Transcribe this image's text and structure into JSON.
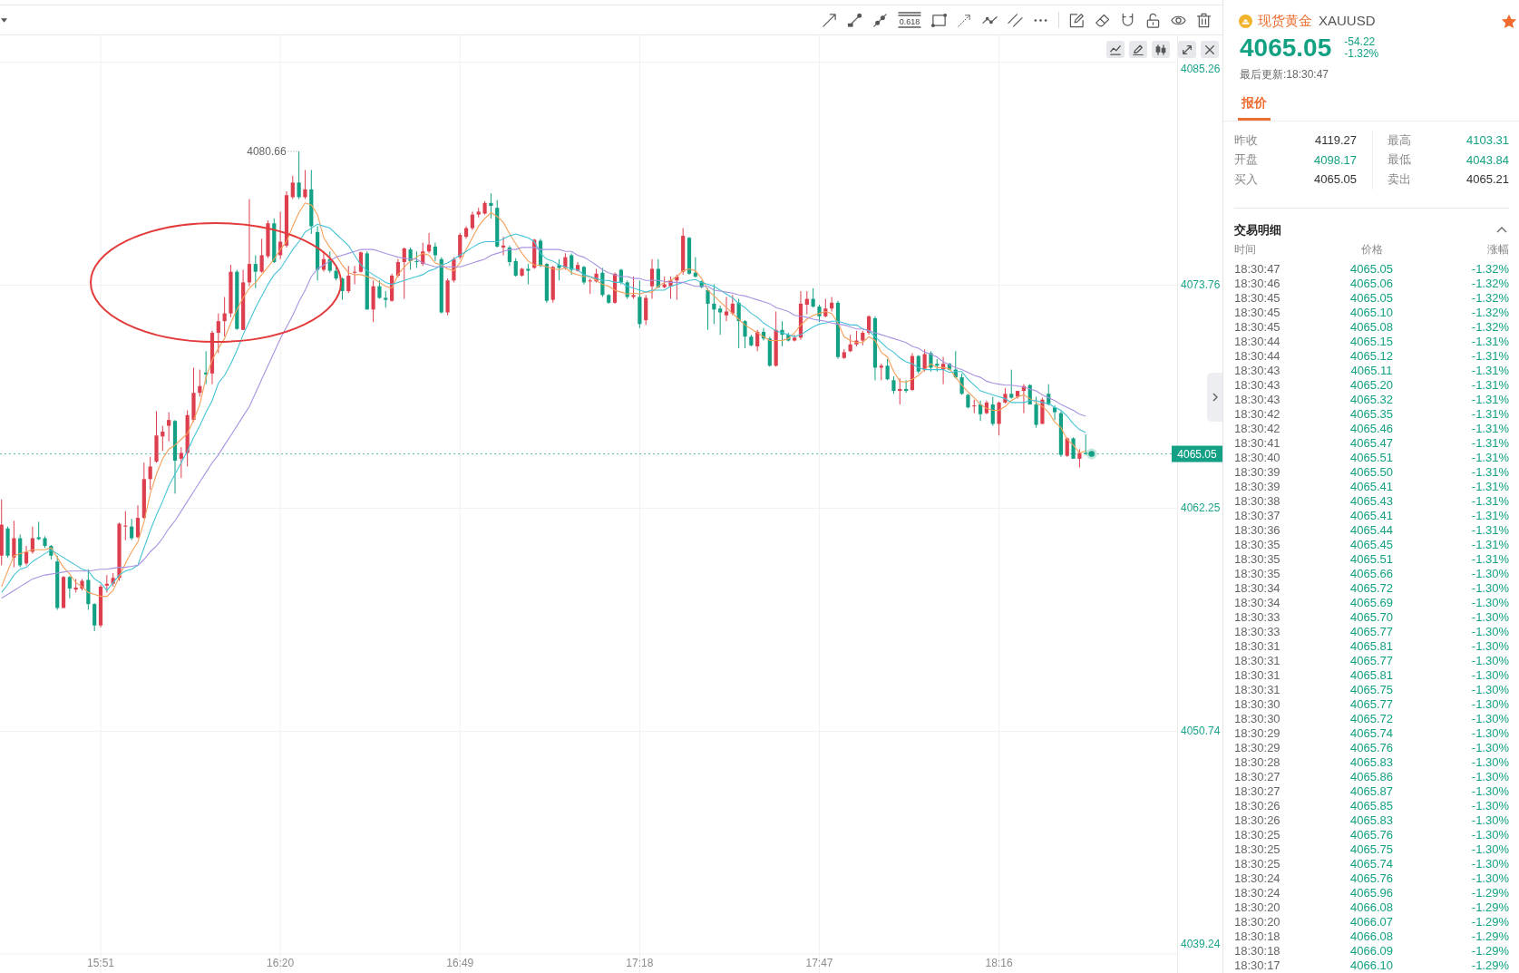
{
  "toolbar": {
    "fib_caption": "0.618"
  },
  "chart": {
    "chart_data": [
      {
        "type": "candlestick",
        "grid": true,
        "ylim": [
          4039.2,
          4086.6
        ],
        "yticks": [
          4085.26,
          4073.76,
          4062.25,
          4050.74,
          4039.24
        ],
        "categories": [
          null,
          null,
          null,
          null,
          null,
          null,
          null,
          null,
          null,
          null,
          null,
          null,
          null,
          null,
          null,
          null,
          "15:51",
          null,
          null,
          null,
          null,
          null,
          null,
          null,
          null,
          null,
          null,
          null,
          null,
          null,
          null,
          null,
          null,
          null,
          null,
          null,
          null,
          null,
          null,
          null,
          null,
          null,
          null,
          null,
          null,
          "16:20",
          null,
          null,
          null,
          null,
          null,
          null,
          null,
          null,
          null,
          null,
          null,
          null,
          null,
          null,
          null,
          null,
          null,
          null,
          null,
          null,
          null,
          null,
          null,
          null,
          null,
          null,
          null,
          null,
          "16:49",
          null,
          null,
          null,
          null,
          null,
          null,
          null,
          null,
          null,
          null,
          null,
          null,
          null,
          null,
          null,
          null,
          null,
          null,
          null,
          null,
          null,
          null,
          null,
          null,
          null,
          null,
          null,
          null,
          "17:18",
          null,
          null,
          null,
          null,
          null,
          null,
          null,
          null,
          null,
          null,
          null,
          null,
          null,
          null,
          null,
          null,
          null,
          null,
          null,
          null,
          null,
          null,
          null,
          null,
          null,
          null,
          null,
          null,
          "17:47",
          null,
          null,
          null,
          null,
          null,
          null,
          null,
          null,
          null,
          null,
          null,
          null,
          null,
          null,
          null,
          null,
          null,
          null,
          null,
          null,
          null,
          null,
          null,
          null,
          null,
          null,
          null,
          null,
          "18:16",
          null,
          null,
          null,
          null,
          null,
          null,
          null,
          null,
          null,
          null,
          null,
          null,
          null,
          null
        ],
        "ohlc": [
          [
            4059.8,
            4062.7,
            4059.3,
            4061.4
          ],
          [
            4061.2,
            4061.3,
            4059.7,
            4059.8
          ],
          [
            4059.7,
            4061.6,
            4059.2,
            4060.7
          ],
          [
            4060.7,
            4060.9,
            4059.2,
            4059.3
          ],
          [
            4059.4,
            4060.3,
            4059.3,
            4060.0
          ],
          [
            4060.0,
            4061.3,
            4059.9,
            4060.7
          ],
          [
            4060.75,
            4061.55,
            4060.6,
            4060.65
          ],
          [
            4060.7,
            4060.8,
            4060.2,
            4060.3
          ],
          [
            4060.3,
            4060.35,
            4059.6,
            4059.8
          ],
          [
            4059.5,
            4059.8,
            4057.0,
            4057.1
          ],
          [
            4057.1,
            4058.75,
            4057.1,
            4058.7
          ],
          [
            4058.7,
            4058.75,
            4057.6,
            4058.1
          ],
          [
            4058.05,
            4058.6,
            4057.9,
            4058.15
          ],
          [
            4058.1,
            4058.6,
            4058.0,
            4058.5
          ],
          [
            4058.55,
            4059.1,
            4057.0,
            4057.3
          ],
          [
            4057.3,
            4057.35,
            4055.9,
            4056.2
          ],
          [
            4056.2,
            4058.3,
            4056.1,
            4058.2
          ],
          [
            4058.25,
            4058.8,
            4057.9,
            4058.35
          ],
          [
            4058.35,
            4058.9,
            4058.2,
            4058.65
          ],
          [
            4058.65,
            4061.5,
            4058.5,
            4061.45
          ],
          [
            4061.3,
            4062.1,
            4060.6,
            4061.35
          ],
          [
            4061.3,
            4061.7,
            4060.6,
            4060.7
          ],
          [
            4060.75,
            4062.4,
            4060.7,
            4061.75
          ],
          [
            4061.75,
            4064.6,
            4061.7,
            4063.75
          ],
          [
            4063.75,
            4064.9,
            4063.2,
            4064.4
          ],
          [
            4064.65,
            4067.25,
            4064.6,
            4066.0
          ],
          [
            4065.95,
            4066.5,
            4065.2,
            4066.2
          ],
          [
            4066.5,
            4067.2,
            4065.7,
            4066.8
          ],
          [
            4066.75,
            4066.8,
            4063.0,
            4064.7
          ],
          [
            4064.8,
            4065.4,
            4063.8,
            4065.1
          ],
          [
            4065.1,
            4067.3,
            4064.4,
            4067.05
          ],
          [
            4066.8,
            4069.5,
            4066.7,
            4068.2
          ],
          [
            4068.2,
            4069.4,
            4068.0,
            4068.55
          ],
          [
            4069.25,
            4070.35,
            4068.65,
            4069.15
          ],
          [
            4069.2,
            4071.4,
            4068.65,
            4071.3
          ],
          [
            4071.3,
            4072.3,
            4070.25,
            4071.9
          ],
          [
            4071.9,
            4073.15,
            4071.1,
            4072.3
          ],
          [
            4072.3,
            4074.8,
            4072.1,
            4074.45
          ],
          [
            4074.45,
            4074.55,
            4071.45,
            4071.5
          ],
          [
            4071.45,
            4074.55,
            4071.45,
            4073.9
          ],
          [
            4073.9,
            4078.2,
            4073.7,
            4074.85
          ],
          [
            4074.85,
            4075.3,
            4073.6,
            4074.45
          ],
          [
            4074.45,
            4076.15,
            4074.4,
            4075.3
          ],
          [
            4075.25,
            4077.1,
            4075.15,
            4076.95
          ],
          [
            4076.95,
            4077.2,
            4074.9,
            4074.95
          ],
          [
            4075.3,
            4077.55,
            4075.1,
            4076.0
          ],
          [
            4075.8,
            4078.6,
            4075.7,
            4078.4
          ],
          [
            4078.3,
            4079.4,
            4078.2,
            4079.05
          ],
          [
            4079.05,
            4080.66,
            4078.2,
            4078.3
          ],
          [
            4078.3,
            4079.7,
            4078.2,
            4078.7
          ],
          [
            4078.7,
            4079.7,
            4076.4,
            4076.8
          ],
          [
            4076.5,
            4076.8,
            4074.0,
            4074.55
          ],
          [
            4074.55,
            4075.5,
            4074.45,
            4075.1
          ],
          [
            4075.1,
            4075.5,
            4074.4,
            4074.5
          ],
          [
            4074.5,
            4074.75,
            4074.0,
            4074.1
          ],
          [
            4074.1,
            4074.15,
            4073.0,
            4073.45
          ],
          [
            4073.45,
            4074.75,
            4073.35,
            4074.25
          ],
          [
            4074.4,
            4074.75,
            4073.8,
            4074.45
          ],
          [
            4074.45,
            4075.5,
            4074.4,
            4075.45
          ],
          [
            4075.4,
            4075.5,
            4072.5,
            4072.5
          ],
          [
            4072.5,
            4074.0,
            4071.85,
            4073.7
          ],
          [
            4073.7,
            4074.0,
            4073.05,
            4073.1
          ],
          [
            4073.1,
            4073.45,
            4072.6,
            4073.0
          ],
          [
            4072.95,
            4074.35,
            4072.9,
            4074.25
          ],
          [
            4074.25,
            4075.1,
            4074.15,
            4074.95
          ],
          [
            4074.95,
            4075.7,
            4073.05,
            4075.65
          ],
          [
            4075.6,
            4075.7,
            4074.55,
            4075.0
          ],
          [
            4075.0,
            4075.5,
            4074.65,
            4074.95
          ],
          [
            4074.85,
            4075.95,
            4074.75,
            4075.5
          ],
          [
            4075.5,
            4076.45,
            4075.4,
            4075.85
          ],
          [
            4075.75,
            4075.95,
            4075.0,
            4075.3
          ],
          [
            4075.1,
            4075.2,
            4072.3,
            4072.35
          ],
          [
            4072.35,
            4074.1,
            4072.2,
            4074.0
          ],
          [
            4074.0,
            4075.2,
            4073.9,
            4075.1
          ],
          [
            4075.2,
            4076.45,
            4075.1,
            4076.35
          ],
          [
            4076.25,
            4076.8,
            4076.15,
            4076.7
          ],
          [
            4076.7,
            4077.55,
            4076.6,
            4077.4
          ],
          [
            4077.4,
            4077.75,
            4077.25,
            4077.55
          ],
          [
            4077.45,
            4078.1,
            4077.4,
            4078.0
          ],
          [
            4078.0,
            4078.5,
            4077.2,
            4077.85
          ],
          [
            4077.75,
            4078.15,
            4075.7,
            4075.75
          ],
          [
            4075.7,
            4076.25,
            4075.3,
            4075.8
          ],
          [
            4075.7,
            4075.8,
            4074.75,
            4074.95
          ],
          [
            4075.0,
            4075.15,
            4074.2,
            4074.25
          ],
          [
            4074.25,
            4074.65,
            4074.2,
            4074.6
          ],
          [
            4074.6,
            4074.85,
            4073.8,
            4074.5
          ],
          [
            4074.65,
            4076.15,
            4074.6,
            4076.1
          ],
          [
            4076.05,
            4076.15,
            4074.7,
            4074.75
          ],
          [
            4074.85,
            4074.9,
            4072.85,
            4072.95
          ],
          [
            4073.0,
            4074.75,
            4072.85,
            4074.7
          ],
          [
            4074.8,
            4075.1,
            4074.0,
            4074.65
          ],
          [
            4074.65,
            4075.4,
            4074.55,
            4075.2
          ],
          [
            4075.3,
            4075.4,
            4074.3,
            4074.55
          ],
          [
            4074.5,
            4074.95,
            4074.45,
            4074.8
          ],
          [
            4074.7,
            4074.75,
            4073.8,
            4073.9
          ],
          [
            4073.95,
            4074.1,
            4073.3,
            4074.0
          ],
          [
            4073.95,
            4074.6,
            4073.9,
            4074.35
          ],
          [
            4074.4,
            4074.65,
            4073.15,
            4073.25
          ],
          [
            4073.25,
            4073.3,
            4072.8,
            4072.85
          ],
          [
            4072.85,
            4074.4,
            4072.8,
            4074.35
          ],
          [
            4074.55,
            4074.6,
            4073.8,
            4073.9
          ],
          [
            4073.9,
            4074.0,
            4073.05,
            4073.15
          ],
          [
            4073.15,
            4074.2,
            4073.05,
            4073.25
          ],
          [
            4073.15,
            4074.0,
            4071.55,
            4071.75
          ],
          [
            4071.95,
            4073.25,
            4071.7,
            4073.1
          ],
          [
            4073.7,
            4075.1,
            4073.05,
            4074.6
          ],
          [
            4074.6,
            4075.1,
            4073.6,
            4073.65
          ],
          [
            4073.65,
            4074.2,
            4073.6,
            4073.8
          ],
          [
            4073.7,
            4074.2,
            4073.05,
            4074.0
          ],
          [
            4074.0,
            4074.3,
            4073.0,
            4074.2
          ],
          [
            4074.45,
            4076.7,
            4074.3,
            4076.3
          ],
          [
            4076.2,
            4076.25,
            4074.3,
            4074.35
          ],
          [
            4074.4,
            4075.2,
            4074.15,
            4074.2
          ],
          [
            4073.95,
            4074.0,
            4073.6,
            4073.65
          ],
          [
            4073.5,
            4073.6,
            4071.45,
            4072.8
          ],
          [
            4072.8,
            4073.8,
            4071.75,
            4072.5
          ],
          [
            4072.55,
            4072.7,
            4071.2,
            4072.35
          ],
          [
            4072.2,
            4073.15,
            4071.9,
            4072.4
          ],
          [
            4072.3,
            4073.25,
            4072.2,
            4072.8
          ],
          [
            4072.85,
            4073.05,
            4070.5,
            4071.9
          ],
          [
            4071.9,
            4071.95,
            4070.5,
            4071.1
          ],
          [
            4071.1,
            4071.2,
            4070.6,
            4070.65
          ],
          [
            4070.6,
            4071.45,
            4070.35,
            4071.35
          ],
          [
            4071.35,
            4071.55,
            4070.9,
            4071.0
          ],
          [
            4071.0,
            4071.1,
            4069.55,
            4069.6
          ],
          [
            4069.6,
            4072.4,
            4069.55,
            4071.45
          ],
          [
            4071.45,
            4071.9,
            4070.6,
            4071.2
          ],
          [
            4071.2,
            4071.3,
            4070.85,
            4070.9
          ],
          [
            4070.9,
            4071.2,
            4070.85,
            4071.05
          ],
          [
            4071.05,
            4073.45,
            4070.95,
            4072.8
          ],
          [
            4072.75,
            4073.45,
            4072.25,
            4073.05
          ],
          [
            4073.05,
            4073.6,
            4072.6,
            4072.65
          ],
          [
            4072.65,
            4072.75,
            4071.85,
            4072.15
          ],
          [
            4072.15,
            4073.05,
            4072.1,
            4072.55
          ],
          [
            4072.55,
            4073.15,
            4072.4,
            4072.85
          ],
          [
            4072.85,
            4072.95,
            4069.95,
            4070.05
          ],
          [
            4070.0,
            4070.45,
            4069.95,
            4070.3
          ],
          [
            4070.35,
            4071.2,
            4070.3,
            4070.7
          ],
          [
            4070.7,
            4071.4,
            4070.6,
            4070.9
          ],
          [
            4070.9,
            4071.4,
            4070.65,
            4071.3
          ],
          [
            4071.3,
            4072.2,
            4071.2,
            4072.15
          ],
          [
            4072.05,
            4072.15,
            4068.85,
            4069.5
          ],
          [
            4069.5,
            4069.7,
            4068.85,
            4069.6
          ],
          [
            4069.6,
            4069.95,
            4068.85,
            4068.9
          ],
          [
            4068.85,
            4069.05,
            4068.15,
            4068.3
          ],
          [
            4068.3,
            4068.95,
            4067.6,
            4068.4
          ],
          [
            4068.4,
            4068.85,
            4068.2,
            4068.3
          ],
          [
            4068.35,
            4070.25,
            4068.3,
            4070.1
          ],
          [
            4070.1,
            4070.15,
            4069.2,
            4069.3
          ],
          [
            4069.4,
            4070.45,
            4069.3,
            4070.2
          ],
          [
            4070.25,
            4070.35,
            4069.3,
            4069.5
          ],
          [
            4069.7,
            4069.95,
            4069.3,
            4069.6
          ],
          [
            4069.4,
            4070.05,
            4068.65,
            4069.7
          ],
          [
            4069.7,
            4069.75,
            4069.35,
            4069.4
          ],
          [
            4069.4,
            4070.35,
            4068.95,
            4069.0
          ],
          [
            4069.0,
            4069.2,
            4068.1,
            4068.15
          ],
          [
            4068.1,
            4068.15,
            4067.4,
            4067.45
          ],
          [
            4067.5,
            4067.85,
            4067.15,
            4067.55
          ],
          [
            4067.6,
            4067.8,
            4066.75,
            4067.1
          ],
          [
            4067.15,
            4067.8,
            4067.1,
            4067.7
          ],
          [
            4067.6,
            4068.0,
            4066.5,
            4066.6
          ],
          [
            4066.6,
            4067.75,
            4066.0,
            4067.7
          ],
          [
            4067.7,
            4068.45,
            4067.65,
            4068.15
          ],
          [
            4068.15,
            4069.4,
            4067.9,
            4067.95
          ],
          [
            4068.0,
            4068.3,
            4067.9,
            4068.3
          ],
          [
            4068.3,
            4068.65,
            4067.15,
            4068.55
          ],
          [
            4068.6,
            4068.65,
            4067.6,
            4067.6
          ],
          [
            4067.6,
            4068.0,
            4066.4,
            4066.55
          ],
          [
            4066.6,
            4067.95,
            4066.6,
            4067.85
          ],
          [
            4068.15,
            4068.65,
            4067.55,
            4067.6
          ],
          [
            4067.45,
            4067.55,
            4066.8,
            4067.2
          ],
          [
            4067.15,
            4067.25,
            4064.9,
            4065.0
          ],
          [
            4064.95,
            4065.9,
            4064.9,
            4065.85
          ],
          [
            4065.85,
            4065.9,
            4064.8,
            4064.8
          ],
          [
            4064.8,
            4065.3,
            4064.35,
            4065.1
          ],
          [
            4065.1,
            4066.05,
            4065.0,
            4065.05
          ]
        ],
        "series": [
          {
            "type": "line",
            "color": "#f5a05a",
            "values": [
              4058.2,
              4059.0,
              4059.8,
              4059.9,
              4060.0,
              4060.1,
              4060.1,
              4060.1,
              4060.2,
              4059.7,
              4059.2,
              4058.85,
              4058.4,
              4058.2,
              4057.9,
              4057.8,
              4057.7,
              4057.7,
              4058.0,
              4058.7,
              4059.4,
              4060.0,
              4060.5,
              4061.55,
              4063.0,
              4064.0,
              4064.8,
              4065.3,
              4065.5,
              4065.8,
              4066.1,
              4066.8,
              4067.6,
              4069.0,
              4069.9,
              4070.5,
              4071.0,
              4071.8,
              4072.5,
              4073.1,
              4073.6,
              4073.9,
              4074.3,
              4074.7,
              4075.1,
              4075.6,
              4076.0,
              4076.8,
              4077.5,
              4078.0,
              4077.9,
              4077.4,
              4076.2,
              4075.7,
              4075.3,
              4074.8,
              4074.4,
              4074.3,
              4074.3,
              4074.2,
              4074.1,
              4073.9,
              4073.7,
              4073.6,
              4074.3,
              4074.7,
              4075.0,
              4075.2,
              4075.4,
              4075.3,
              4074.9,
              4074.8,
              4074.6,
              4074.5,
              4074.9,
              4075.6,
              4076.2,
              4076.8,
              4077.2,
              4077.5,
              4077.3,
              4077.0,
              4076.4,
              4075.9,
              4075.4,
              4075.0,
              4074.8,
              4074.8,
              4074.7,
              4074.6,
              4074.55,
              4074.65,
              4074.4,
              4074.3,
              4074.2,
              4074.2,
              4074.0,
              4073.8,
              4073.7,
              4073.5,
              4073.4,
              4073.3,
              4073.35,
              4073.3,
              4073.4,
              4073.4,
              4073.7,
              4073.9,
              4074.0,
              4074.2,
              4074.5,
              4074.6,
              4074.5,
              4074.1,
              4073.5,
              4073.2,
              4072.9,
              4072.6,
              4072.3,
              4072.0,
              4071.7,
              4071.5,
              4071.3,
              4071.1,
              4070.9,
              4070.9,
              4070.9,
              4071.0,
              4071.3,
              4071.7,
              4072.0,
              4072.2,
              4072.3,
              4072.4,
              4072.3,
              4071.8,
              4071.1,
              4070.9,
              4070.8,
              4070.8,
              4071.1,
              4070.9,
              4070.3,
              4070.05,
              4069.3,
              4068.8,
              4068.75,
              4068.9,
              4069.1,
              4069.4,
              4069.7,
              4069.5,
              4069.5,
              4069.45,
              4069.0,
              4068.6,
              4068.25,
              4067.95,
              4067.6,
              4067.4,
              4067.3,
              4067.3,
              4067.5,
              4067.8,
              4068.0,
              4068.1,
              4067.9,
              4067.7,
              4067.5,
              4067.2,
              4066.7,
              4066.4,
              4065.8,
              4065.5,
              4065.1,
              4065.2
            ]
          },
          {
            "type": "line",
            "color": "#45c3d6",
            "values": [
              4057.9,
              4058.3,
              4058.8,
              4059.1,
              4059.2,
              4059.5,
              4059.7,
              4059.9,
              4060.1,
              4059.9,
              4059.7,
              4059.5,
              4059.3,
              4059.1,
              4059.0,
              4058.6,
              4058.4,
              4058.0,
              4058.4,
              4058.8,
              4059.0,
              4059.1,
              4059.3,
              4060.2,
              4061.1,
              4061.9,
              4062.6,
              4063.4,
              4064.0,
              4064.6,
              4065.2,
              4065.9,
              4066.5,
              4067.2,
              4067.8,
              4068.7,
              4069.1,
              4069.7,
              4070.4,
              4071.2,
              4071.9,
              4072.6,
              4073.2,
              4073.8,
              4074.3,
              4074.6,
              4075.1,
              4075.6,
              4076.0,
              4076.5,
              4076.7,
              4076.9,
              4076.8,
              4076.7,
              4076.4,
              4076.1,
              4075.8,
              4075.3,
              4074.8,
              4074.5,
              4074.3,
              4074.1,
              4073.9,
              4073.8,
              4073.9,
              4074.0,
              4074.1,
              4074.2,
              4074.3,
              4074.5,
              4074.6,
              4074.8,
              4074.9,
              4075.1,
              4075.3,
              4075.5,
              4075.7,
              4075.9,
              4076.0,
              4076.0,
              4076.0,
              4076.15,
              4076.3,
              4076.4,
              4076.3,
              4076.2,
              4076.0,
              4075.4,
              4075.1,
              4075.0,
              4074.8,
              4074.7,
              4074.6,
              4074.55,
              4074.3,
              4074.2,
              4074.1,
              4074.0,
              4074.0,
              4073.9,
              4073.9,
              4073.7,
              4073.6,
              4073.5,
              4073.4,
              4073.5,
              4073.5,
              4073.5,
              4073.7,
              4073.8,
              4073.9,
              4074.0,
              4074.05,
              4073.9,
              4073.8,
              4073.7,
              4073.5,
              4073.3,
              4073.1,
              4072.8,
              4072.6,
              4072.3,
              4072.1,
              4071.8,
              4071.6,
              4071.4,
              4071.3,
              4071.2,
              4071.1,
              4071.2,
              4071.4,
              4071.6,
              4071.75,
              4071.8,
              4071.9,
              4071.9,
              4071.8,
              4071.7,
              4071.7,
              4071.5,
              4071.4,
              4071.1,
              4070.8,
              4070.5,
              4070.3,
              4070.0,
              4069.8,
              4069.7,
              4069.5,
              4069.4,
              4069.4,
              4069.4,
              4069.4,
              4069.25,
              4069.3,
              4069.3,
              4068.9,
              4068.6,
              4068.3,
              4068.2,
              4068.1,
              4068.0,
              4067.9,
              4067.7,
              4067.7,
              4067.7,
              4067.8,
              4067.8,
              4067.7,
              4067.65,
              4067.45,
              4067.3,
              4067.0,
              4066.6,
              4066.3,
              4066.15
            ]
          },
          {
            "type": "line",
            "color": "#a993e0",
            "values": [
              4057.6,
              4057.8,
              4058.0,
              4058.2,
              4058.4,
              4058.6,
              4058.7,
              4058.8,
              4058.85,
              4058.9,
              4058.95,
              4059.0,
              4059.0,
              4059.0,
              4059.0,
              4059.05,
              4059.1,
              4059.1,
              4059.15,
              4059.2,
              4059.2,
              4059.25,
              4059.3,
              4059.6,
              4060.0,
              4060.3,
              4060.7,
              4061.2,
              4061.6,
              4062.1,
              4062.6,
              4063.1,
              4063.6,
              4064.1,
              4064.6,
              4065.0,
              4065.5,
              4066.0,
              4066.5,
              4067.0,
              4067.5,
              4068.2,
              4068.9,
              4069.6,
              4070.3,
              4071.0,
              4071.6,
              4072.2,
              4072.9,
              4073.5,
              4074.2,
              4074.6,
              4074.8,
              4075.0,
              4075.2,
              4075.3,
              4075.4,
              4075.5,
              4075.6,
              4075.6,
              4075.6,
              4075.5,
              4075.4,
              4075.3,
              4075.2,
              4075.15,
              4075.1,
              4075.1,
              4074.9,
              4074.8,
              4074.7,
              4074.7,
              4074.7,
              4074.7,
              4074.7,
              4074.8,
              4074.9,
              4075.0,
              4075.1,
              4075.3,
              4075.4,
              4075.5,
              4075.6,
              4075.6,
              4075.7,
              4075.7,
              4075.7,
              4075.6,
              4075.6,
              4075.6,
              4075.6,
              4075.5,
              4075.5,
              4075.3,
              4075.2,
              4075.0,
              4074.8,
              4074.55,
              4074.4,
              4074.3,
              4074.2,
              4074.2,
              4074.1,
              4074.1,
              4074.0,
              4074.0,
              4074.0,
              4073.95,
              4073.9,
              4073.9,
              4073.9,
              4073.8,
              4073.7,
              4073.7,
              4073.7,
              4073.5,
              4073.45,
              4073.4,
              4073.35,
              4073.25,
              4073.2,
              4073.1,
              4073.0,
              4072.9,
              4072.8,
              4072.6,
              4072.5,
              4072.4,
              4072.2,
              4072.15,
              4072.1,
              4072.0,
              4071.95,
              4071.9,
              4071.8,
              4071.75,
              4071.7,
              4071.6,
              4071.5,
              4071.5,
              4071.4,
              4071.3,
              4071.2,
              4071.1,
              4071.0,
              4070.9,
              4070.8,
              4070.6,
              4070.5,
              4070.3,
              4070.2,
              4070.05,
              4069.8,
              4069.65,
              4069.5,
              4069.4,
              4069.25,
              4069.1,
              4069.0,
              4068.8,
              4068.7,
              4068.65,
              4068.6,
              4068.6,
              4068.55,
              4068.5,
              4068.4,
              4068.3,
              4068.1,
              4067.95,
              4067.8,
              4067.6,
              4067.45,
              4067.3,
              4067.1,
              4067.0
            ]
          }
        ],
        "ref_lines": [
          {
            "axis": "y",
            "value": 4065.05,
            "label": "4065.05",
            "color": "#14a085",
            "line_style": "dotted"
          }
        ],
        "annotations": [
          "4080.66"
        ]
      }
    ]
  },
  "symbol": {
    "name": "现货黄金",
    "code": "XAUUSD",
    "favorite": true
  },
  "quote": {
    "price": "4065.05",
    "change": "-54.22",
    "change_percent": "-1.32%",
    "last_update": "最后更新:18:30:47"
  },
  "tabs": [
    {
      "label": "报价",
      "selected": true
    }
  ],
  "stats": [
    {
      "label": "昨收",
      "value": "4119.27",
      "color": "#333333"
    },
    {
      "label": "最高",
      "value": "4103.31",
      "color": "#12a182"
    },
    {
      "label": "开盘",
      "value": "4098.17",
      "color": "#12a182"
    },
    {
      "label": "最低",
      "value": "4043.84",
      "color": "#12a182"
    },
    {
      "label": "买入",
      "value": "4065.05",
      "color": "#333333"
    },
    {
      "label": "卖出",
      "value": "4065.21",
      "color": "#333333"
    }
  ],
  "trades": {
    "title": "交易明细",
    "expanded": true,
    "columns": [
      "时间",
      "价格",
      "涨幅"
    ],
    "rows": [
      [
        "18:30:47",
        "4065.05",
        "-1.32%"
      ],
      [
        "18:30:46",
        "4065.06",
        "-1.32%"
      ],
      [
        "18:30:45",
        "4065.05",
        "-1.32%"
      ],
      [
        "18:30:45",
        "4065.10",
        "-1.32%"
      ],
      [
        "18:30:45",
        "4065.08",
        "-1.32%"
      ],
      [
        "18:30:44",
        "4065.15",
        "-1.31%"
      ],
      [
        "18:30:44",
        "4065.12",
        "-1.31%"
      ],
      [
        "18:30:43",
        "4065.11",
        "-1.31%"
      ],
      [
        "18:30:43",
        "4065.20",
        "-1.31%"
      ],
      [
        "18:30:43",
        "4065.32",
        "-1.31%"
      ],
      [
        "18:30:42",
        "4065.35",
        "-1.31%"
      ],
      [
        "18:30:42",
        "4065.46",
        "-1.31%"
      ],
      [
        "18:30:41",
        "4065.47",
        "-1.31%"
      ],
      [
        "18:30:40",
        "4065.51",
        "-1.31%"
      ],
      [
        "18:30:39",
        "4065.50",
        "-1.31%"
      ],
      [
        "18:30:39",
        "4065.41",
        "-1.31%"
      ],
      [
        "18:30:38",
        "4065.43",
        "-1.31%"
      ],
      [
        "18:30:37",
        "4065.41",
        "-1.31%"
      ],
      [
        "18:30:36",
        "4065.44",
        "-1.31%"
      ],
      [
        "18:30:35",
        "4065.45",
        "-1.31%"
      ],
      [
        "18:30:35",
        "4065.51",
        "-1.31%"
      ],
      [
        "18:30:35",
        "4065.66",
        "-1.30%"
      ],
      [
        "18:30:34",
        "4065.72",
        "-1.30%"
      ],
      [
        "18:30:34",
        "4065.69",
        "-1.30%"
      ],
      [
        "18:30:33",
        "4065.70",
        "-1.30%"
      ],
      [
        "18:30:33",
        "4065.77",
        "-1.30%"
      ],
      [
        "18:30:31",
        "4065.81",
        "-1.30%"
      ],
      [
        "18:30:31",
        "4065.77",
        "-1.30%"
      ],
      [
        "18:30:31",
        "4065.81",
        "-1.30%"
      ],
      [
        "18:30:31",
        "4065.75",
        "-1.30%"
      ],
      [
        "18:30:30",
        "4065.77",
        "-1.30%"
      ],
      [
        "18:30:30",
        "4065.72",
        "-1.30%"
      ],
      [
        "18:30:29",
        "4065.74",
        "-1.30%"
      ],
      [
        "18:30:29",
        "4065.76",
        "-1.30%"
      ],
      [
        "18:30:28",
        "4065.83",
        "-1.30%"
      ],
      [
        "18:30:27",
        "4065.86",
        "-1.30%"
      ],
      [
        "18:30:27",
        "4065.87",
        "-1.30%"
      ],
      [
        "18:30:26",
        "4065.85",
        "-1.30%"
      ],
      [
        "18:30:26",
        "4065.83",
        "-1.30%"
      ],
      [
        "18:30:25",
        "4065.76",
        "-1.30%"
      ],
      [
        "18:30:25",
        "4065.75",
        "-1.30%"
      ],
      [
        "18:30:25",
        "4065.74",
        "-1.30%"
      ],
      [
        "18:30:24",
        "4065.76",
        "-1.30%"
      ],
      [
        "18:30:24",
        "4065.96",
        "-1.29%"
      ],
      [
        "18:30:20",
        "4066.08",
        "-1.29%"
      ],
      [
        "18:30:20",
        "4066.07",
        "-1.29%"
      ],
      [
        "18:30:18",
        "4066.08",
        "-1.29%"
      ],
      [
        "18:30:18",
        "4066.09",
        "-1.29%"
      ],
      [
        "18:30:17",
        "4066.10",
        "-1.29%"
      ]
    ]
  }
}
